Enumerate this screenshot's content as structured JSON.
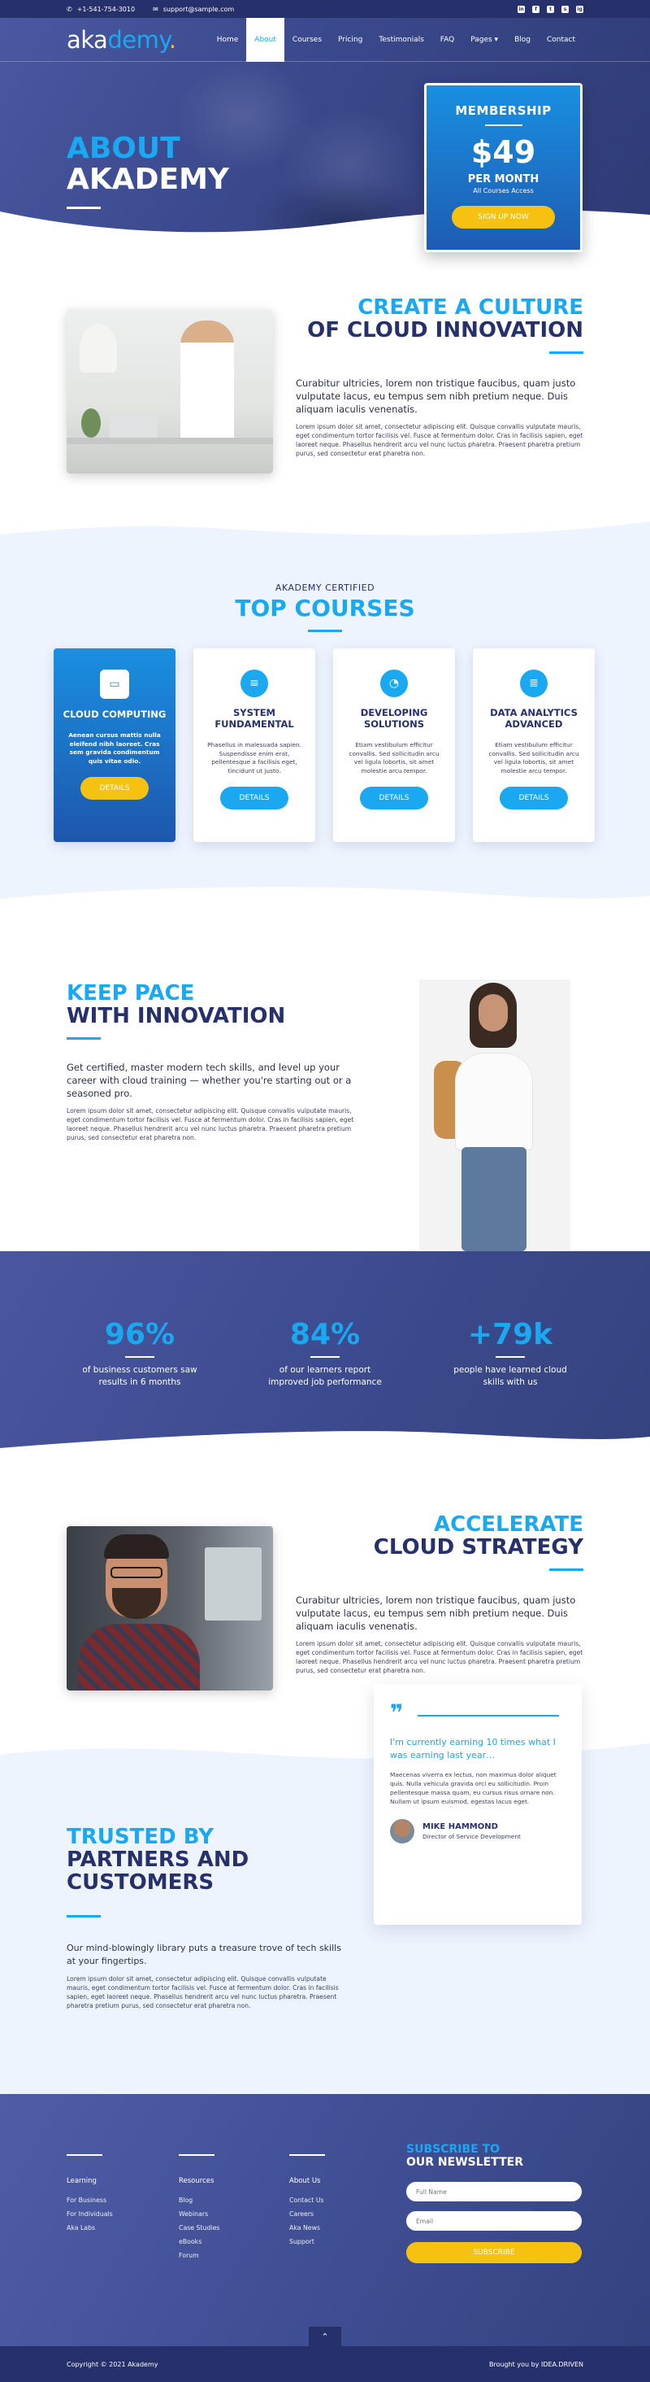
{
  "topbar": {
    "phone": "+1-541-754-3010",
    "email": "support@sample.com",
    "social": [
      "in",
      "f",
      "t",
      "s",
      "ig"
    ]
  },
  "nav": {
    "logo_part1": "aka",
    "logo_part2": "demy",
    "logo_dot": ".",
    "items": [
      "Home",
      "About",
      "Courses",
      "Pricing",
      "Testimonials",
      "FAQ",
      "Pages ▾",
      "Blog",
      "Contact"
    ],
    "active": "About"
  },
  "hero": {
    "title_line1": "ABOUT",
    "title_line2": "AKADEMY"
  },
  "membership": {
    "title": "MEMBERSHIP",
    "price": "$49",
    "period": "PER MONTH",
    "subtitle": "All Courses Access",
    "button": "SIGN UP NOW"
  },
  "culture": {
    "title_line1": "CREATE A CULTURE",
    "title_line2": "OF CLOUD INNOVATION",
    "lead": "Curabitur ultricies, lorem non tristique faucibus, quam justo vulputate lacus, eu tempus sem nibh pretium neque. Duis aliquam iaculis venenatis.",
    "body": "Lorem ipsum dolor sit amet, consectetur adipiscing elit. Quisque convallis vulputate mauris, eget condimentum tortor facilisis vel. Fusce at fermentum dolor. Cras in facilisis sapien, eget laoreet neque. Phasellus hendrerit arcu vel nunc luctus pharetra. Praesent pharetra pretium purus, sed consectetur erat pharetra non."
  },
  "courses": {
    "kicker": "AKADEMY CERTIFIED",
    "title": "TOP COURSES",
    "items": [
      {
        "icon": "▭",
        "title_line1": "CLOUD COMPUTING",
        "title_line2": "",
        "desc": "Aenean cursus mattis nulla eleifend nibh laoreet. Cras sem gravida condimentum quis vitae odio.",
        "button": "DETAILS"
      },
      {
        "icon": "≡",
        "title_line1": "SYSTEM",
        "title_line2": "FUNDAMENTAL",
        "desc": "Phasellus in malesuada sapien. Suspendisse enim erat, pellentesque a facilisis eget, tincidunt ut justo.",
        "button": "DETAILS"
      },
      {
        "icon": "◔",
        "title_line1": "DEVELOPING",
        "title_line2": "SOLUTIONS",
        "desc": "Etiam vestibulum efficitur convallis. Sed sollicitudin arcu vel ligula lobortis, sit amet molestie arcu tempor.",
        "button": "DETAILS"
      },
      {
        "icon": "≣",
        "title_line1": "DATA ANALYTICS",
        "title_line2": "ADVANCED",
        "desc": "Etiam vestibulum efficitur convallis. Sed sollicitudin arcu vel ligula lobortis, sit amet molestie arcu tempor.",
        "button": "DETAILS"
      }
    ]
  },
  "pace": {
    "title_line1": "KEEP PACE",
    "title_line2": "WITH INNOVATION",
    "lead": "Get certified, master modern tech skills, and level up your career with cloud training — whether you're starting out or a seasoned pro.",
    "body": "Lorem ipsum dolor sit amet, consectetur adipiscing elit. Quisque convallis vulputate mauris, eget condimentum tortor facilisis vel. Fusce at fermentum dolor. Cras in facilisis sapien, eget laoreet neque. Phasellus hendrerit arcu vel nunc luctus pharetra. Praesent pharetra pretium purus, sed consectetur erat pharetra non."
  },
  "stats": [
    {
      "value": "96%",
      "label_line1": "of business customers saw",
      "label_line2": "results in 6 months"
    },
    {
      "value": "84%",
      "label_line1": "of our learners report",
      "label_line2": "improved job performance"
    },
    {
      "value": "+79k",
      "label_line1": "people have learned cloud",
      "label_line2": "skills with us"
    }
  ],
  "accelerate": {
    "title_line1": "ACCELERATE",
    "title_line2": "CLOUD STRATEGY",
    "lead": "Curabitur ultricies, lorem non tristique faucibus, quam justo vulputate lacus, eu tempus sem nibh pretium neque. Duis aliquam iaculis venenatis.",
    "body": "Lorem ipsum dolor sit amet, consectetur adipiscing elit. Quisque convallis vulputate mauris, eget condimentum tortor facilisis vel. Fusce at fermentum dolor. Cras in facilisis sapien, eget laoreet neque. Phasellus hendrerit arcu vel nunc luctus pharetra. Praesent pharetra pretium purus, sed consectetur erat pharetra non."
  },
  "trusted": {
    "title_line1": "TRUSTED BY",
    "title_line2": "PARTNERS AND",
    "title_line3": "CUSTOMERS",
    "lead": "Our mind-blowingly library puts a treasure trove of tech skills at your fingertips.",
    "body": "Lorem ipsum dolor sit amet, consectetur adipiscing elit. Quisque convallis vulputate mauris, eget condimentum tortor facilisis vel. Fusce at fermentum dolor. Cras in facilisis sapien, eget laoreet neque. Phasellus hendrerit arcu vel nunc luctus pharetra. Praesent pharetra pretium purus, sed consectetur erat pharetra non."
  },
  "testimonial": {
    "mark": "❞",
    "quote": "I'm currently earning 10 times what I was earning last year…",
    "text": "Maecenas viverra ex lectus, non maximus dolor aliquet quis. Nulla vehicula gravida orci eu sollicitudin. Proin pellentesque massa quam, eu cursus risus ornare non. Nullam ut ipsum euismod, egestas lacus eget.",
    "name": "MIKE HAMMOND",
    "role": "Director of Service Development"
  },
  "footer": {
    "columns": [
      {
        "heading": "Learning",
        "links": [
          "For Business",
          "For Individuals",
          "Aka Labs"
        ]
      },
      {
        "heading": "Resources",
        "links": [
          "Blog",
          "Webinars",
          "Case Studies",
          "eBooks",
          "Forum"
        ]
      },
      {
        "heading": "About Us",
        "links": [
          "Contact Us",
          "Careers",
          "Aka News",
          "Support"
        ]
      }
    ],
    "newsletter_line1": "SUBSCRIBE TO",
    "newsletter_line2": "OUR NEWSLETTER",
    "name_placeholder": "Full Name",
    "email_placeholder": "Email",
    "subscribe": "SUBSCRIBE",
    "to_top": "⌃",
    "copyright": "Copyright © 2021 Akademy",
    "credit": "Brought you by IDEA.DRIVEN"
  }
}
